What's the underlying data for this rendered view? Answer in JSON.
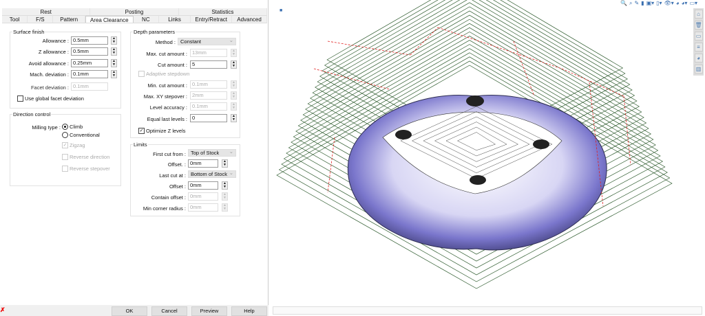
{
  "tabs_row1": [
    "Rest",
    "Posting",
    "Statistics"
  ],
  "tabs_row2": [
    "Tool",
    "F/S",
    "Pattern",
    "Area Clearance",
    "NC",
    "Links",
    "Entry/Retract",
    "Advanced"
  ],
  "active_tab": "Area Clearance",
  "surface_finish": {
    "title": "Surface finish",
    "allowance": {
      "label": "Allowance :",
      "value": "0.5mm"
    },
    "z_allowance": {
      "label": "Z allowance :",
      "value": "0.5mm"
    },
    "avoid_allowance": {
      "label": "Avoid allowance :",
      "value": "0.25mm"
    },
    "mach_deviation": {
      "label": "Mach. deviation :",
      "value": "0.1mm"
    },
    "facet_deviation": {
      "label": "Facet deviation :",
      "value": "0.1mm"
    },
    "use_global": {
      "label": "Use global facet deviation",
      "checked": false
    }
  },
  "direction_control": {
    "title": "Direction control",
    "milling_type_label": "Milling type :",
    "climb": "Climb",
    "conventional": "Conventional",
    "selected": "Climb",
    "zigzag": "Zigzag",
    "reverse_direction": "Reverse direction",
    "reverse_stepover": "Reverse stepover"
  },
  "depth": {
    "title": "Depth parameters",
    "method": {
      "label": "Method :",
      "value": "Constant"
    },
    "max_cut": {
      "label": "Max. cut amount :",
      "value": "13mm"
    },
    "cut_amount": {
      "label": "Cut amount :",
      "value": "5"
    },
    "adaptive": "Adaptive stepdown",
    "min_cut": {
      "label": "Min. cut amount :",
      "value": "0.1mm"
    },
    "max_xy": {
      "label": "Max. XY stepover :",
      "value": "2mm"
    },
    "level_acc": {
      "label": "Level accuracy :",
      "value": "0.1mm"
    },
    "equal_last": {
      "label": "Equal last levels :",
      "value": "0"
    },
    "optimize": {
      "label": "Optimize Z levels",
      "checked": true
    }
  },
  "limits": {
    "title": "Limits",
    "first_cut": {
      "label": "First cut from :",
      "value": "Top of Stock"
    },
    "offset1": {
      "label": "Offset. :",
      "value": "0mm"
    },
    "last_cut": {
      "label": "Last cut at :",
      "value": "Bottom of Stock"
    },
    "offset2": {
      "label": "Offset :",
      "value": "0mm"
    },
    "contain": {
      "label": "Contain offset :",
      "value": "0mm"
    },
    "min_corner": {
      "label": "Min corner radius :",
      "value": "0mm"
    }
  },
  "buttons": {
    "ok": "OK",
    "cancel": "Cancel",
    "preview": "Preview",
    "help": "Help"
  },
  "colors": {
    "toolpath": "#2d5a2d",
    "rapid": "#e02020",
    "part": "#8a86d8"
  }
}
